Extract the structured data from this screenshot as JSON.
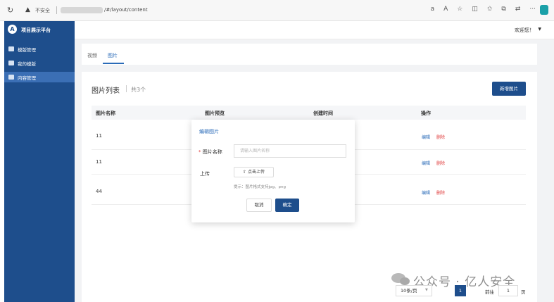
{
  "browser": {
    "reload_icon": "reload-icon",
    "security_text": "不安全",
    "url": "/#/layout/content",
    "tool_icons": [
      "read-aloud-icon",
      "font-icon",
      "favorite-icon",
      "split-screen-icon",
      "favorites-icon",
      "collections-icon",
      "extensions-icon",
      "more-icon"
    ],
    "tool_glyphs": [
      "a",
      "A",
      "☆",
      "◫",
      "✩",
      "⧉",
      "⇄",
      "···"
    ]
  },
  "app": {
    "logo_letter": "A",
    "title": "项目展示平台"
  },
  "sidebar": {
    "items": [
      {
        "label": "模版管理",
        "active": false
      },
      {
        "label": "我的模版",
        "active": false
      },
      {
        "label": "内容管理",
        "active": true
      }
    ]
  },
  "header": {
    "welcome": "欢迎您！",
    "caret": "▼"
  },
  "tabs": [
    {
      "label": "视频",
      "active": false
    },
    {
      "label": "图片",
      "active": true
    }
  ],
  "list": {
    "title": "图片列表",
    "count": "共3个",
    "add_button": "新增图片"
  },
  "table": {
    "columns": [
      "图片名称",
      "图片预览",
      "创建时间",
      "操作"
    ],
    "rows": [
      {
        "name": "11",
        "edit": "编辑",
        "delete": "删除"
      },
      {
        "name": "11",
        "edit": "编辑",
        "delete": "删除"
      },
      {
        "name": "44",
        "edit": "编辑",
        "delete": "删除"
      }
    ]
  },
  "pagination": {
    "page_size": "10条/页",
    "current_page": "1",
    "goto_label": "前往",
    "goto_value": "1",
    "unit": "页"
  },
  "watermark": "公众号 · 亿人安全",
  "dialog": {
    "title": "编辑图片",
    "required_mark": "*",
    "name_label": "图片名称",
    "name_placeholder": "请输入图片名称",
    "upload_label": "上传",
    "upload_button": "点击上传",
    "upload_tip": "提示：图片格式支持jpg、png",
    "cancel": "取消",
    "confirm": "确定"
  }
}
